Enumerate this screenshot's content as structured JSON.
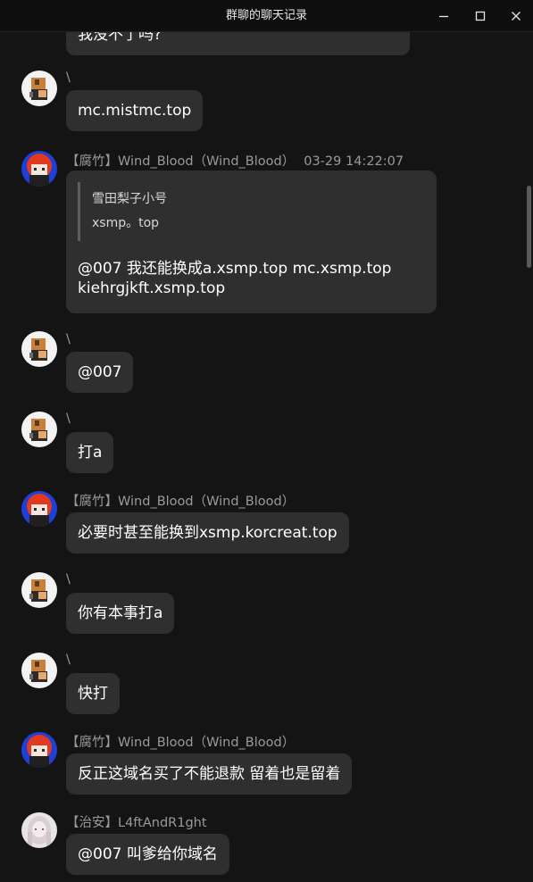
{
  "window": {
    "title": "群聊的聊天记录"
  },
  "icons": {
    "minimize": "minimize-icon",
    "maximize": "maximize-icon",
    "close": "close-icon"
  },
  "colors": {
    "background": "#141414",
    "bubble": "#2f2f2f",
    "sender_text": "#9a9a9a",
    "quote_bar": "#5e5e5e"
  },
  "messages": [
    {
      "sender": "",
      "text": "我没不了吗?"
    },
    {
      "sender": "\\",
      "text": "mc.mistmc.top"
    },
    {
      "sender": "【腐竹】Wind_Blood（Wind_Blood）",
      "time": "03-29 14:22:07",
      "quote": {
        "name": "雪田梨子小号",
        "text": "xsmp。top"
      },
      "lines": [
        "@007 我还能换成a.xsmp.top mc.xsmp.top",
        "kiehrgjkft.xsmp.top"
      ]
    },
    {
      "sender": "\\",
      "text": "@007"
    },
    {
      "sender": "\\",
      "text": "打a"
    },
    {
      "sender": "【腐竹】Wind_Blood（Wind_Blood）",
      "text": "必要时甚至能换到xsmp.korcreat.top"
    },
    {
      "sender": "\\",
      "text": "你有本事打a"
    },
    {
      "sender": "\\",
      "text": "快打"
    },
    {
      "sender": "【腐竹】Wind_Blood（Wind_Blood）",
      "text": "反正这域名买了不能退款 留着也是留着"
    },
    {
      "sender": "【治安】L4ftAndR1ght",
      "text": "@007 叫爹给你域名"
    }
  ]
}
